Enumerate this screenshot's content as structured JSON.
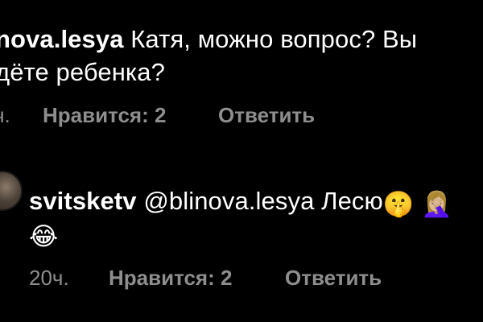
{
  "comment1": {
    "username": "nova.lesya",
    "text_line1": "Катя, можно вопрос? Вы",
    "text_line2": "дёте ребенка?",
    "time": "ч.",
    "likes_label": "Нравится: 2",
    "reply_label": "Ответить"
  },
  "comment2": {
    "username": "svitsketv",
    "mention": "@blinova.lesya",
    "text": "Лесю",
    "emoji_1": "🤫",
    "emoji_2": "🤦🏼‍♀️",
    "emoji_3": "😂",
    "time": "20ч.",
    "likes_label": "Нравится: 2",
    "reply_label": "Ответить"
  },
  "colors": {
    "background": "#000000",
    "text": "#ffffff",
    "secondary": "#8e8e8e"
  },
  "icons": {
    "avatar": "user-avatar"
  }
}
